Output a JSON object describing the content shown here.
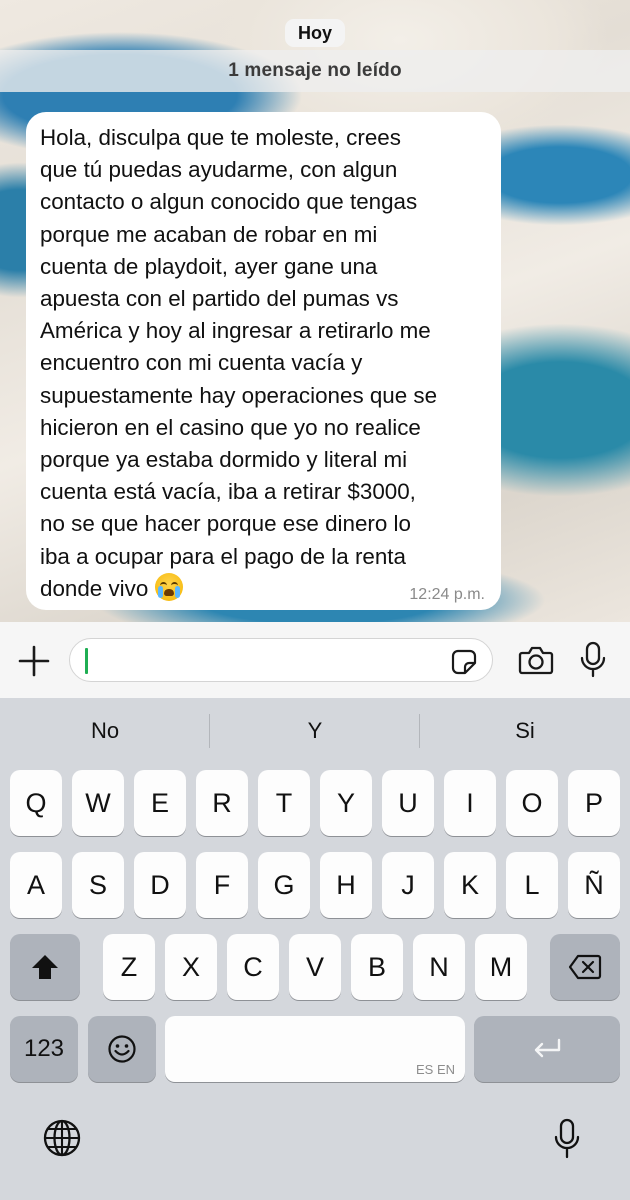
{
  "chat": {
    "date_label": "Hoy",
    "unread_label": "1 mensaje no leído",
    "message": {
      "lines": [
        "Hola, disculpa que te moleste, crees",
        "que tú puedas ayudarme, con algun",
        "contacto o algun conocido que tengas",
        "porque me acaban de robar en mi",
        "cuenta de playdoit, ayer gane una",
        "apuesta con el partido del pumas vs",
        "América y hoy al ingresar a retirarlo me",
        "encuentro con mi cuenta vacía y",
        "supuestamente hay operaciones que se",
        "hicieron en el casino que yo no realice",
        "porque ya estaba dormido y literal mi",
        "cuenta está vacía, iba a retirar $3000,",
        "no se que hacer porque ese dinero lo",
        "iba a ocupar para el pago de la renta",
        "donde vivo"
      ],
      "emoji": "loudly-crying-face",
      "time": "12:24 p.m."
    }
  },
  "input_bar": {
    "text_value": "",
    "icons": [
      "plus-icon",
      "sticker-icon",
      "camera-icon",
      "microphone-icon"
    ]
  },
  "keyboard": {
    "predictions": [
      "No",
      "Y",
      "Si"
    ],
    "row1": [
      "Q",
      "W",
      "E",
      "R",
      "T",
      "Y",
      "U",
      "I",
      "O",
      "P"
    ],
    "row2": [
      "A",
      "S",
      "D",
      "F",
      "G",
      "H",
      "J",
      "K",
      "L",
      "Ñ"
    ],
    "row3": [
      "Z",
      "X",
      "C",
      "V",
      "B",
      "N",
      "M"
    ],
    "numbers_label": "123",
    "space_hint": "ES EN",
    "icons": [
      "shift-icon",
      "backspace-icon",
      "emoji-icon",
      "return-icon",
      "globe-icon",
      "dictation-icon"
    ]
  },
  "colors": {
    "caret": "#1fae53",
    "keyboard_bg": "#d4d7dc",
    "key_bg": "#fdfdfd",
    "dark_key_bg": "#aeb3bb"
  }
}
